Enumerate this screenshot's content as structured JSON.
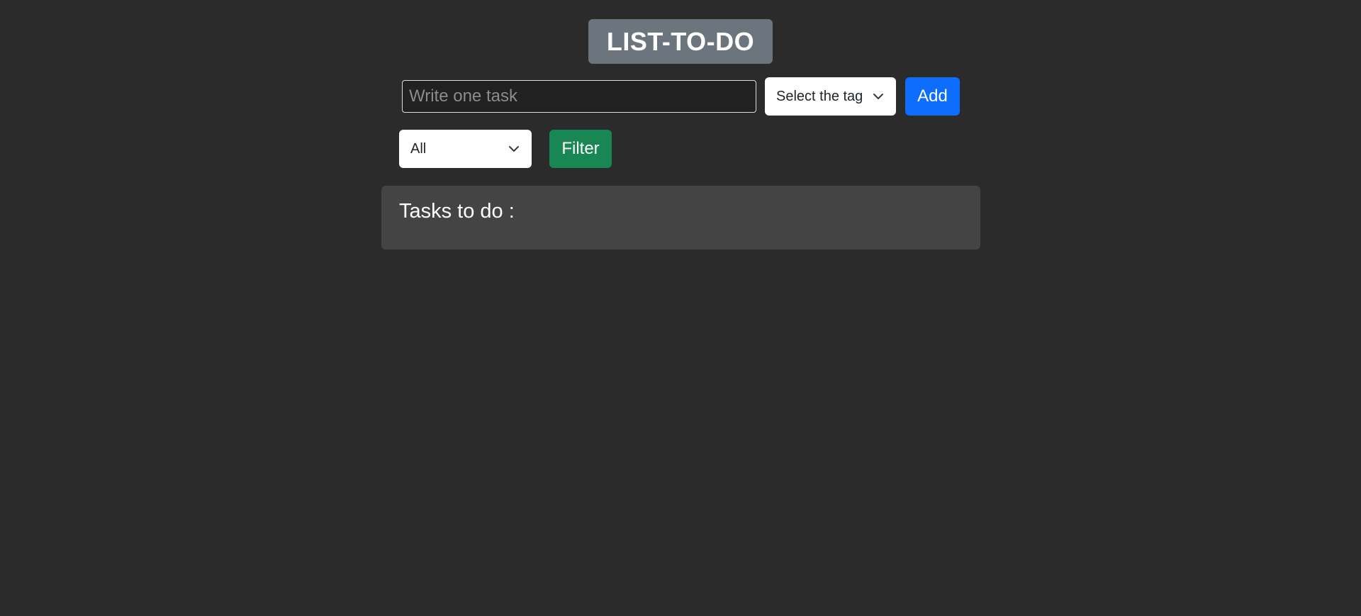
{
  "header": {
    "title": "LIST-TO-DO"
  },
  "task_form": {
    "input_placeholder": "Write one task",
    "input_value": "",
    "tag_select_value": "Select the tag",
    "add_label": "Add"
  },
  "filter_bar": {
    "filter_select_value": "All",
    "filter_label": "Filter"
  },
  "tasks": {
    "heading": "Tasks to do :",
    "items": []
  },
  "colors": {
    "background": "#2b2b2b",
    "title_bg": "#6c757d",
    "add_button": "#0d6efd",
    "filter_button": "#198754",
    "panel_bg": "#444444"
  },
  "icons": {
    "select_chevron": "chevron-down-icon"
  }
}
